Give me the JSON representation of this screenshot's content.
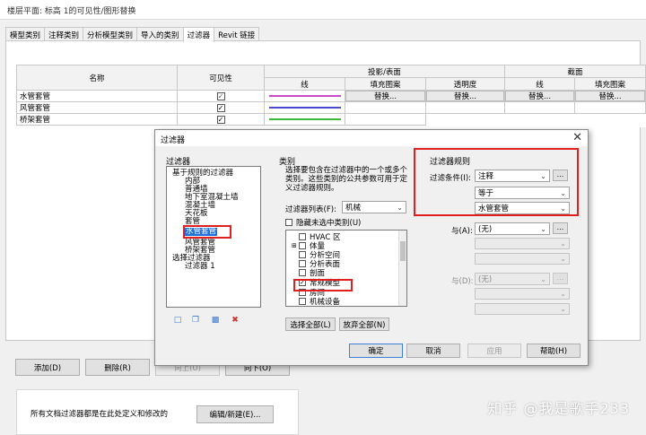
{
  "window_title": "楼层平面: 标高 1的可见性/图形替换",
  "tabs": [
    "模型类别",
    "注释类别",
    "分析模型类别",
    "导入的类别",
    "过滤器",
    "Revit 链接"
  ],
  "table": {
    "headers": {
      "name": "名称",
      "visibility": "可见性",
      "projection_surface": "投影/表面",
      "section": "截面",
      "line": "线",
      "fill_pattern": "填充图案",
      "transparency": "透明度",
      "sec_line": "线",
      "sec_fill": "填充图案"
    },
    "rows": [
      {
        "name": "水管套管",
        "line_color": "#c84cc8",
        "replace": "替换..."
      },
      {
        "name": "风管套管",
        "line_color": "#4848d0",
        "replace": ""
      },
      {
        "name": "桥架套管",
        "line_color": "#3cb83c",
        "replace": ""
      }
    ],
    "check": "✓"
  },
  "bottom_buttons": {
    "add": "添加(D)",
    "remove": "删除(R)",
    "up": "向上(U)",
    "down": "向下(O)"
  },
  "info": {
    "text": "所有文档过滤器都是在此处定义和修改的",
    "edit": "编辑/新建(E)..."
  },
  "dialog": {
    "title": "过滤器",
    "close": "✕",
    "filters_label": "过滤器",
    "tree": [
      "基于规则的过滤器",
      "内部",
      "普通墙",
      "地下室混凝土墙",
      "混凝土墙",
      "天花板",
      "套管",
      "水管套管",
      "风管套管",
      "桥架套管",
      "选择过滤器",
      "过滤器 1"
    ],
    "icons": [
      "new-icon",
      "copy-icon",
      "rename-icon",
      "delete-icon"
    ],
    "categories_label": "类别",
    "cat_desc": "选择要包含在过滤器中的一个或多个类别。这些类别的公共参数可用于定义过滤器规则。",
    "filter_list_label": "过滤器列表(F):",
    "filter_list_value": "机械",
    "hide_unchecked": "隐藏未选中类别(U)",
    "categories": [
      {
        "label": "HVAC 区",
        "checked": false
      },
      {
        "label": "体量",
        "checked": false
      },
      {
        "label": "分析空间",
        "checked": false
      },
      {
        "label": "分析表面",
        "checked": false
      },
      {
        "label": "剖面",
        "checked": false
      },
      {
        "label": "常规模型",
        "checked": true
      },
      {
        "label": "房间",
        "checked": false
      },
      {
        "label": "机械设备",
        "checked": false
      },
      {
        "label": "标高",
        "checked": false
      }
    ],
    "select_all": "选择全部(L)",
    "deselect_all": "放弃全部(N)",
    "rules_label": "过滤器规则",
    "condition_label": "过滤条件(I):",
    "condition_value": "注释",
    "operator_value": "等于",
    "value_value": "水管套管",
    "and_label": "与(A):",
    "and_value": "(无)",
    "and2_label": "与(D):",
    "and2_value": "(无)",
    "ellipsis": "...",
    "ok": "确定",
    "cancel": "取消",
    "apply": "应用",
    "help": "帮助(H)"
  },
  "watermark": "知乎 @我是歌手233"
}
